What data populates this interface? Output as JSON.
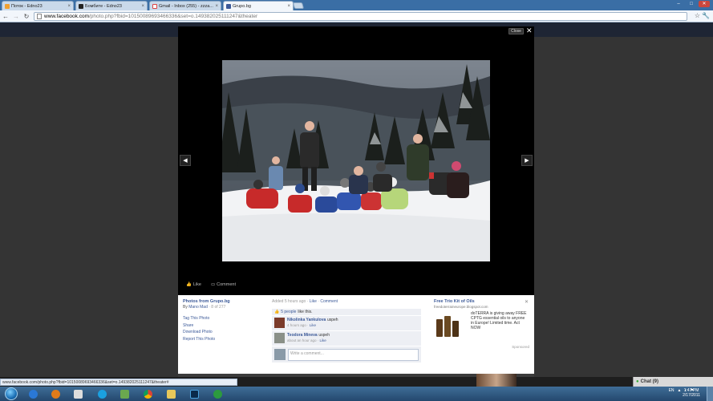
{
  "browser": {
    "tabs": [
      {
        "label": "Поток - Edno23",
        "color": "#f0a030"
      },
      {
        "label": "Бомбите - Edno23",
        "color": "#222222"
      },
      {
        "label": "Gmail - Inbox (255) - zzza...",
        "color": "#d44"
      },
      {
        "label": "Grupo.bg",
        "color": "#3b5998",
        "active": true
      }
    ],
    "url_domain": "www.facebook.com",
    "url_path": "/photo.php?fbid=10150089693466336&set=o.149382025111247&theater",
    "status_url": "www.facebook.com/photo.php?fbid=10150089693466336&set=o.149382025111247&theater#"
  },
  "theater": {
    "close_label": "Close",
    "like_label": "Like",
    "comment_label": "Comment"
  },
  "photo_info": {
    "album_title": "Photos from Grupo.bg",
    "by_prefix": "By",
    "author": "Mano Mad",
    "count": "· 8 of 277",
    "links": [
      "Tag This Photo",
      "Share",
      "Download Photo",
      "Report This Photo"
    ]
  },
  "activity": {
    "added": "Added 5 hours ago ·",
    "like_link": "Like",
    "comment_link": "Comment",
    "likes_count": "5 people",
    "likes_suffix": "like this.",
    "comments": [
      {
        "name": "Nikolinka Yankulova",
        "text": "uspeh",
        "time": "4 hours ago ·",
        "like": "Like",
        "avatar_color": "#7a3a2a"
      },
      {
        "name": "Teodora Mineva",
        "text": "uspeh",
        "time": "about an hour ago ·",
        "like": "Like",
        "avatar_color": "#8a9088"
      }
    ],
    "write_placeholder": "Write a comment..."
  },
  "ad": {
    "title": "Free Trio Kit of Oils",
    "url": "freedoterraineurope.blogspot.com",
    "text": "doTERRA is giving away FREE CPTG essential oils to anyone in Europe! Limited time. Act NOW",
    "sponsored": "Sponsored"
  },
  "chat": {
    "label": "Chat (9)"
  },
  "taskbar": {
    "apps": [
      "internet-explorer-icon",
      "media-player-icon",
      "counter-strike-icon",
      "skype-icon",
      "image-viewer-icon",
      "chrome-icon",
      "explorer-icon",
      "photoshop-icon",
      "utorrent-icon"
    ],
    "lang": "EN",
    "time": "1:47 PM",
    "date": "2/17/2011"
  }
}
